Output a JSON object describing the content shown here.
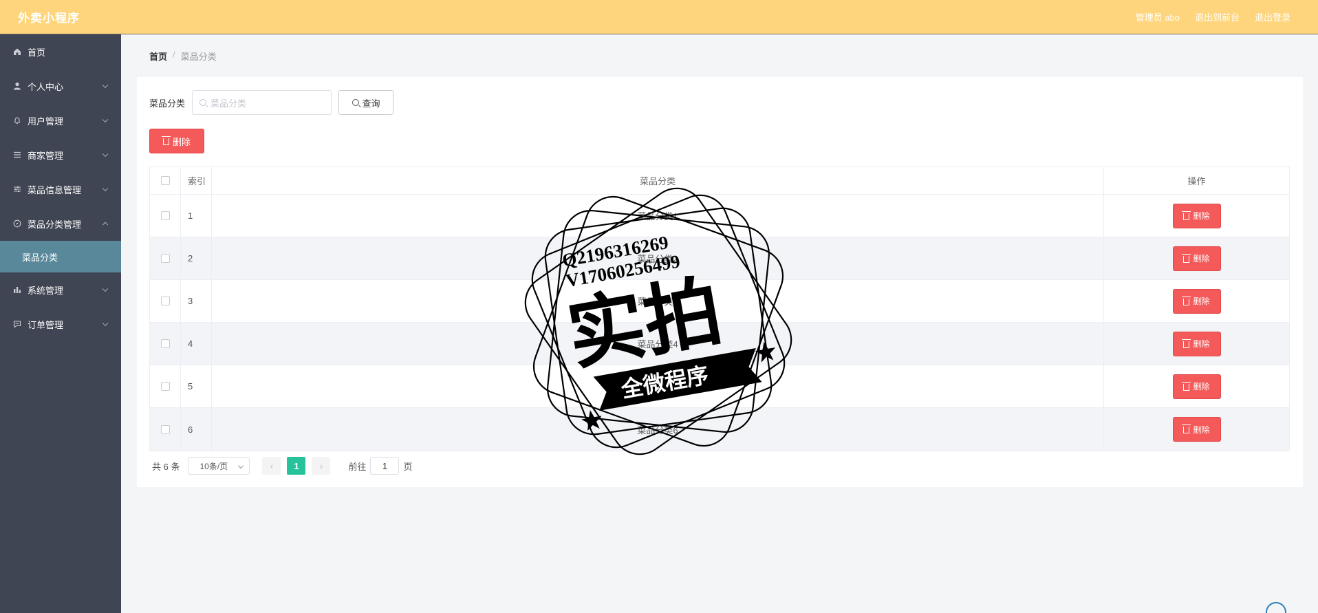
{
  "header": {
    "app_title": "外卖小程序",
    "admin_label": "管理员 abo",
    "exit_front": "退出到前台",
    "logout": "退出登录"
  },
  "sidebar": {
    "items": [
      {
        "label": "首页",
        "icon": "home-icon"
      },
      {
        "label": "个人中心",
        "icon": "user-icon"
      },
      {
        "label": "用户管理",
        "icon": "bell-icon"
      },
      {
        "label": "商家管理",
        "icon": "list-icon"
      },
      {
        "label": "菜品信息管理",
        "icon": "sliders-icon"
      },
      {
        "label": "菜品分类管理",
        "icon": "compass-icon"
      },
      {
        "label": "系统管理",
        "icon": "bar-chart-icon"
      },
      {
        "label": "订单管理",
        "icon": "chat-icon"
      }
    ],
    "sub_active": "菜品分类"
  },
  "breadcrumb": {
    "home": "首页",
    "separator": "/",
    "current": "菜品分类"
  },
  "search": {
    "label": "菜品分类",
    "placeholder": "菜品分类",
    "query_button": "查询"
  },
  "toolbar": {
    "delete_label": "删除"
  },
  "table": {
    "columns": [
      "索引",
      "菜品分类",
      "操作"
    ],
    "rows": [
      {
        "index": "1",
        "name": "菜品分类1"
      },
      {
        "index": "2",
        "name": "菜品分类2"
      },
      {
        "index": "3",
        "name": "菜品分类3"
      },
      {
        "index": "4",
        "name": "菜品分类4"
      },
      {
        "index": "5",
        "name": "菜品分类5"
      },
      {
        "index": "6",
        "name": "菜品分类6"
      }
    ],
    "row_action": "删除"
  },
  "pagination": {
    "total": "共 6 条",
    "page_size": "10条/页",
    "current_page": "1",
    "goto_label": "前往",
    "goto_value": "1",
    "page_suffix": "页",
    "prev": "‹",
    "next": "›"
  },
  "watermark": {
    "line1": "Q2196316269",
    "line2": "V17060256499",
    "big_text": "实拍",
    "banner_text": "全微程序"
  },
  "colors": {
    "header_bg": "#fed57c",
    "sidebar_bg": "#404553",
    "active_sub_bg": "#58889a",
    "danger": "#f55a5a",
    "page_active": "#26c39b"
  }
}
